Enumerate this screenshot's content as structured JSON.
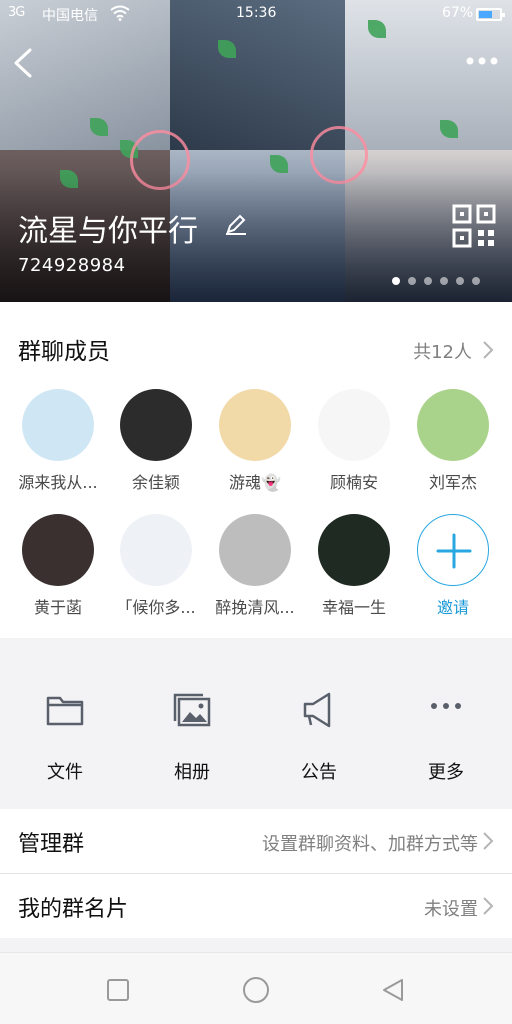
{
  "status_bar": {
    "signal": "3G",
    "carrier": "中国电信",
    "time": "15:36",
    "battery": "67%"
  },
  "header": {
    "group_name": "流星与你平行",
    "group_id": "724928984",
    "banner_count": 6,
    "banner_active": 0
  },
  "members": {
    "title": "群聊成员",
    "count": "共12人",
    "list": [
      {
        "name": "源来我从...",
        "color": "#cfe7f5"
      },
      {
        "name": "余佳颖",
        "color": "#2c2c2c"
      },
      {
        "name": "游魂👻",
        "color": "#f2d9a8"
      },
      {
        "name": "顾楠安",
        "color": "#f6f6f6"
      },
      {
        "name": "刘军杰",
        "color": "#a9d38a"
      },
      {
        "name": "黄于菡",
        "color": "#3a3030"
      },
      {
        "name": "「候你多...",
        "color": "#eef1f6"
      },
      {
        "name": "醉挽清风...",
        "color": "#bdbdbd"
      },
      {
        "name": "幸福一生",
        "color": "#1f2a22"
      }
    ],
    "invite_label": "邀请"
  },
  "shortcuts": [
    {
      "label": "文件",
      "icon": "folder-icon"
    },
    {
      "label": "相册",
      "icon": "photo-album-icon"
    },
    {
      "label": "公告",
      "icon": "megaphone-icon"
    },
    {
      "label": "更多",
      "icon": "more-dots-icon"
    }
  ],
  "rows": {
    "manage": {
      "label": "管理群",
      "value": "设置群聊资料、加群方式等"
    },
    "card": {
      "label": "我的群名片",
      "value": "未设置"
    }
  },
  "colors": {
    "accent": "#1a9ad6",
    "icon_gray": "#59606b"
  }
}
